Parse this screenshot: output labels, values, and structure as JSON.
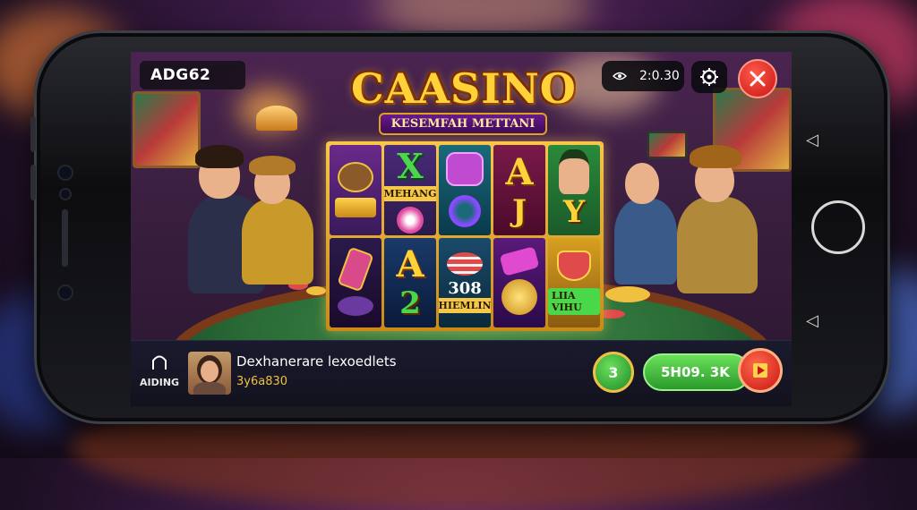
{
  "hud": {
    "player_id": "ADG62",
    "clock": "2:0.30",
    "eye_icon": "eye-icon",
    "settings_icon": "gear-icon",
    "close_icon": "close-icon"
  },
  "logo": {
    "title": "CAASINO",
    "subtitle": "KESEMFAH METTANI"
  },
  "reels": {
    "row1": [
      {
        "kind": "monkey",
        "text": ""
      },
      {
        "kind": "x",
        "text": "X",
        "caption": "MEHANG"
      },
      {
        "kind": "purse",
        "text": ""
      },
      {
        "kind": "a",
        "text": "A",
        "sub": "J"
      },
      {
        "kind": "leprechaun",
        "text": "",
        "sub": "Y"
      }
    ],
    "row1_bottom": [
      {
        "kind": "gold",
        "text": ""
      },
      {
        "kind": "chip",
        "text": ""
      },
      {
        "kind": "ring",
        "text": ""
      },
      {
        "kind": "letter",
        "text": "J"
      },
      {
        "kind": "letter",
        "text": "Y"
      }
    ],
    "row2": [
      {
        "kind": "bottle",
        "text": ""
      },
      {
        "kind": "a",
        "text": "A",
        "sub": "2"
      },
      {
        "kind": "chips-stack",
        "text": "308",
        "caption": "HIEMLIN"
      },
      {
        "kind": "bar",
        "text": ""
      },
      {
        "kind": "pot",
        "text": "",
        "caption": "LIIA VIHU"
      }
    ]
  },
  "bottom": {
    "home_label": "AIDING",
    "home_icon": "home-icon",
    "player_name": "Dexhanerare lexoedlets",
    "balance": "3y6a830",
    "bonus_value": "3",
    "spin_amount": "5H09. 3K",
    "spin_icon": "play-icon"
  },
  "colors": {
    "gold": "#ffd23a",
    "green_button": "#3ab83a",
    "red_button": "#d81a1a",
    "felt": "#2a6a36"
  }
}
